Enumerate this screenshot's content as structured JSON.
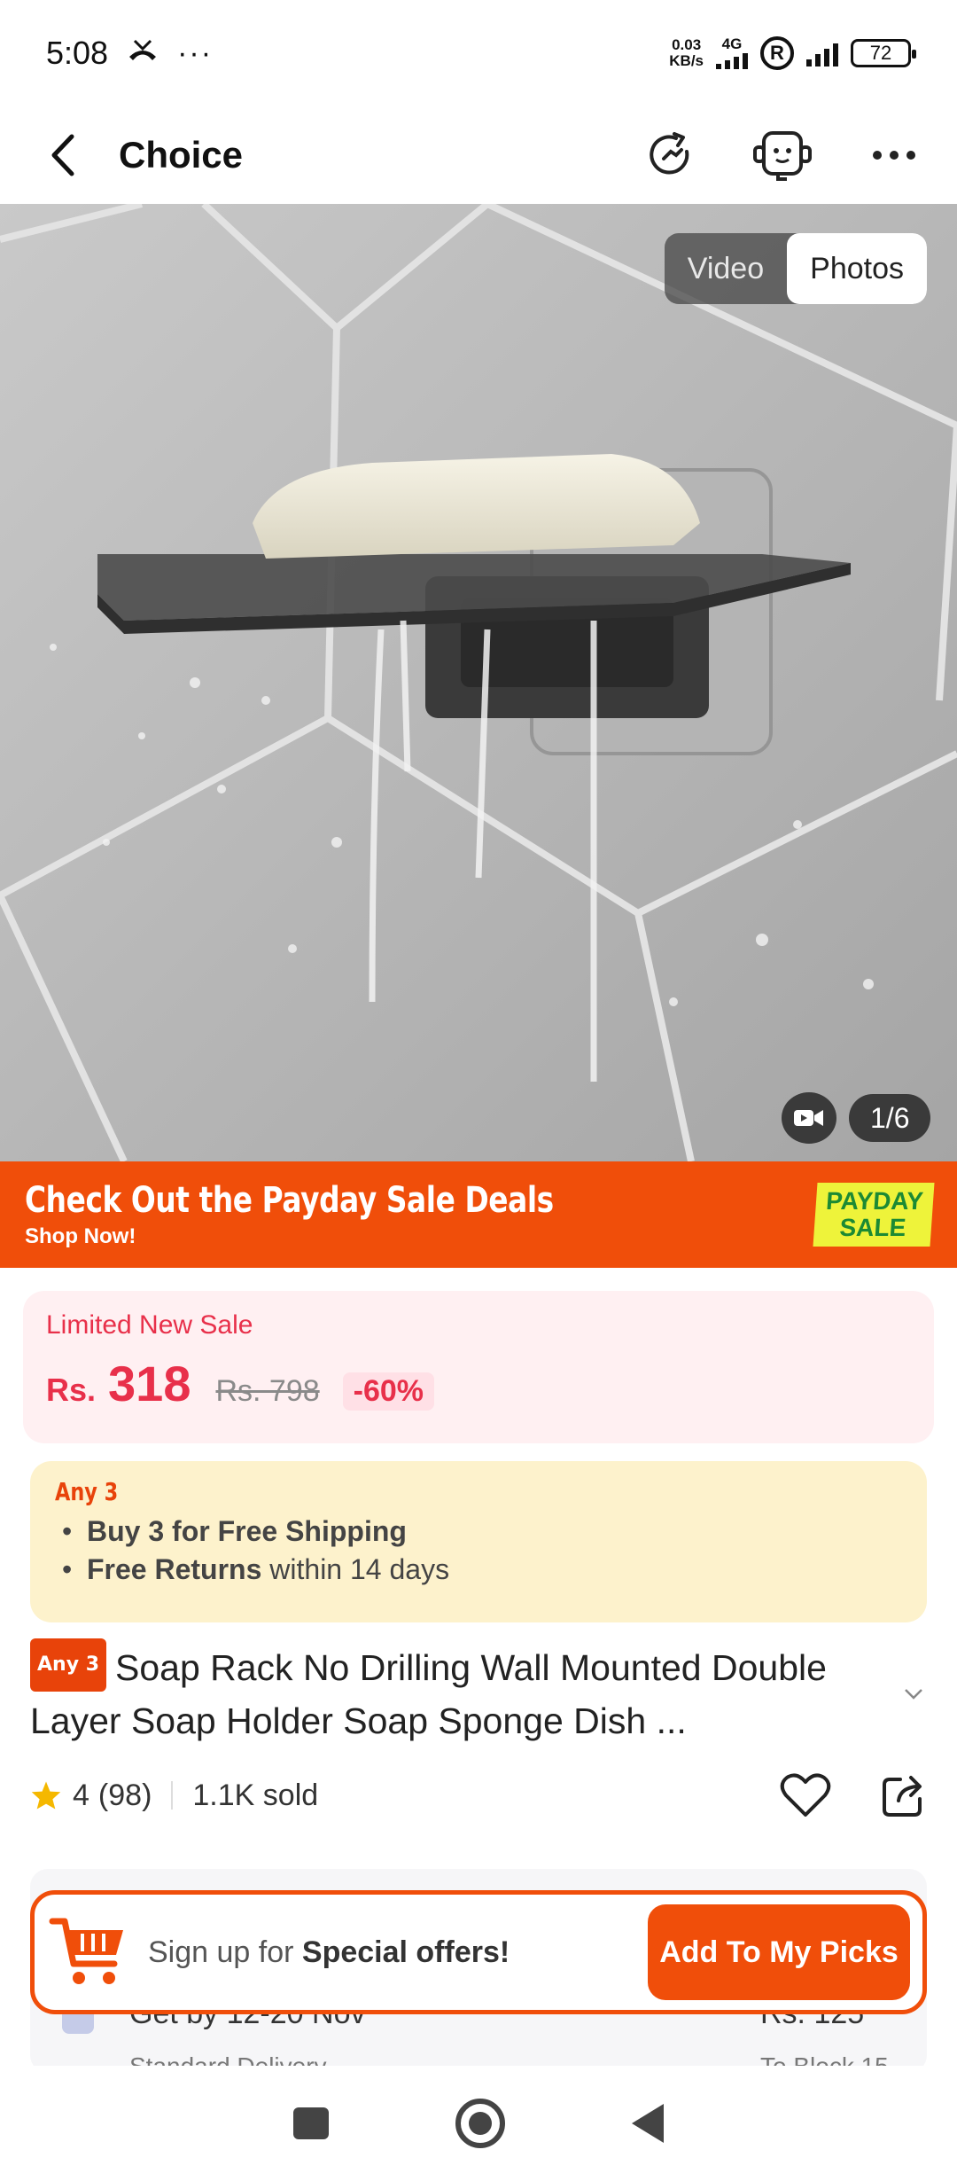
{
  "status_bar": {
    "time": "5:08",
    "net_speed_value": "0.03",
    "net_speed_unit": "KB/s",
    "network_type": "4G",
    "roaming": "R",
    "battery": "72"
  },
  "header": {
    "title": "Choice"
  },
  "media": {
    "tabs": [
      {
        "label": "Video",
        "active": false
      },
      {
        "label": "Photos",
        "active": true
      }
    ],
    "page_counter": "1/6"
  },
  "banner": {
    "title": "Check Out the Payday Sale Deals",
    "subtitle": "Shop Now!",
    "badge_line1": "PAYDAY",
    "badge_line2": "SALE"
  },
  "price": {
    "label": "Limited New Sale",
    "currency": "Rs.",
    "amount": "318",
    "original": "Rs. 798",
    "discount": "-60%"
  },
  "offer": {
    "tag": "Any 3",
    "line1_bold": "Buy 3 for  Free Shipping",
    "line2_bold": "Free Returns",
    "line2_rest": " within 14 days"
  },
  "product": {
    "tag": "Any 3",
    "title": "Soap Rack No Drilling Wall Mounted Double Layer Soap Holder Soap Sponge Dish ..."
  },
  "rating": {
    "score": "4",
    "count": "(98)",
    "sold": "1.1K sold"
  },
  "shipping": {
    "delivery": "Get by 12-20 Nov",
    "method": "Standard Delivery",
    "fee": "Rs. 125",
    "destination": "To Block 15"
  },
  "signup": {
    "text_prefix": "Sign up for ",
    "text_bold": "Special offers!",
    "button_label": "Add To My Picks"
  },
  "colors": {
    "accent": "#f04e0a",
    "price_red": "#e8304a",
    "offer_bg": "#fdf2cc",
    "price_bg": "#fff0f2",
    "badge_yellow": "#eef33a"
  }
}
